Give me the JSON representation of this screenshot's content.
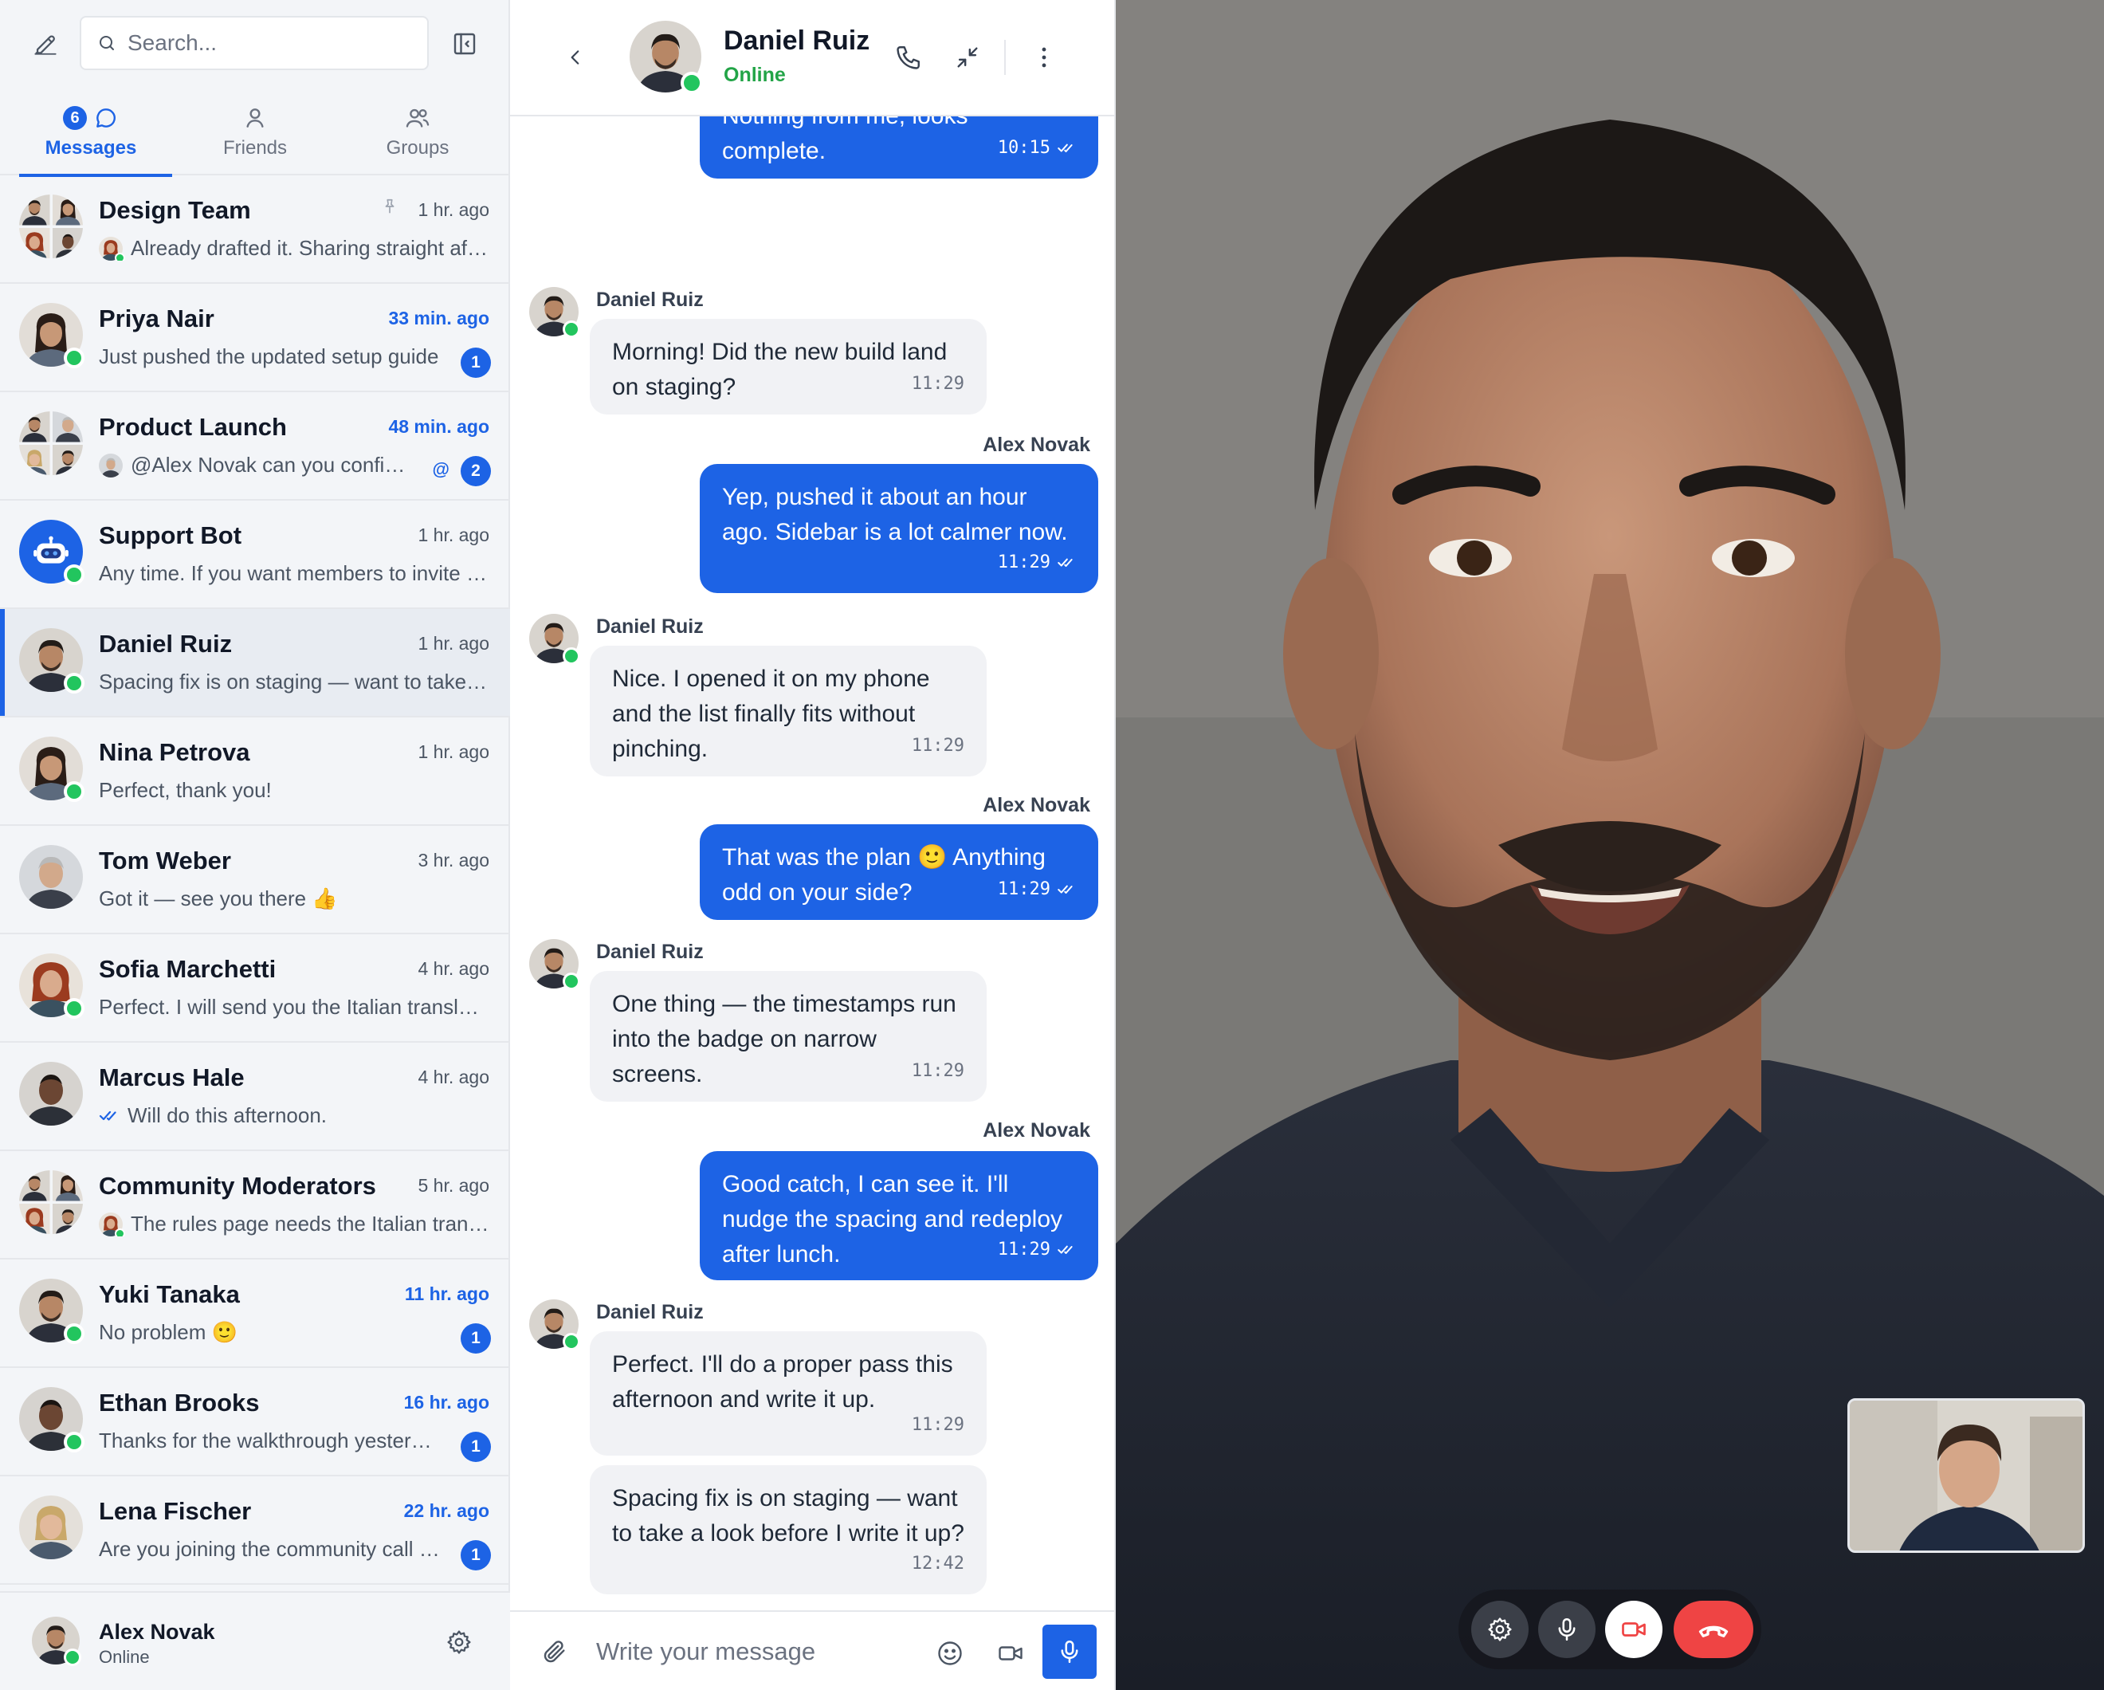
{
  "sidebar": {
    "search_placeholder": "Search...",
    "tabs": [
      {
        "label": "Messages",
        "badge": "6",
        "active": true
      },
      {
        "label": "Friends"
      },
      {
        "label": "Groups"
      }
    ],
    "conversations": [
      {
        "name": "Design Team",
        "time": "1 hr. ago",
        "preview": "Already drafted it. Sharing straight after this.",
        "pinned": true
      },
      {
        "name": "Priya Nair",
        "time": "33 min. ago",
        "preview": "Just pushed the updated setup guide",
        "unread": "1"
      },
      {
        "name": "Product Launch",
        "time": "48 min. ago",
        "preview": "@Alex Novak can you confirm the date?",
        "mention": "@",
        "unread": "2"
      },
      {
        "name": "Support Bot",
        "time": "1 hr. ago",
        "preview": "Any time. If you want members to invite others…"
      },
      {
        "name": "Daniel Ruiz",
        "time": "1 hr. ago",
        "preview": "Spacing fix is on staging — want to take a look?",
        "active": true
      },
      {
        "name": "Nina Petrova",
        "time": "1 hr. ago",
        "preview": "Perfect, thank you!"
      },
      {
        "name": "Tom Weber",
        "time": "3 hr. ago",
        "preview": "Got it — see you there 👍"
      },
      {
        "name": "Sofia Marchetti",
        "time": "4 hr. ago",
        "preview": "Perfect. I will send you the Italian translation soon."
      },
      {
        "name": "Marcus Hale",
        "time": "4 hr. ago",
        "preview": "Will do this afternoon."
      },
      {
        "name": "Community Moderators",
        "time": "5 hr. ago",
        "preview": "The rules page needs the Italian translation"
      },
      {
        "name": "Yuki Tanaka",
        "time": "11 hr. ago",
        "preview": "No problem 🙂",
        "unread": "1"
      },
      {
        "name": "Ethan Brooks",
        "time": "16 hr. ago",
        "preview": "Thanks for the walkthrough yesterday!",
        "unread": "1"
      },
      {
        "name": "Lena Fischer",
        "time": "22 hr. ago",
        "preview": "Are you joining the community call later?",
        "unread": "1"
      }
    ],
    "me": {
      "name": "Alex Novak",
      "status": "Online"
    }
  },
  "chat": {
    "contact": {
      "name": "Daniel Ruiz",
      "status": "Online"
    },
    "messages": [
      {
        "dir": "out",
        "text": "Nothing from me, looks complete.",
        "time": "10:15"
      },
      {
        "dir": "in",
        "sender": "Daniel Ruiz",
        "text": "Morning! Did the new build land on staging?",
        "time": "11:29"
      },
      {
        "dir": "out",
        "sender": "Alex Novak",
        "text": "Yep, pushed it about an hour ago. Sidebar is a lot calmer now.",
        "time": "11:29"
      },
      {
        "dir": "in",
        "sender": "Daniel Ruiz",
        "text": "Nice. I opened it on my phone and the list finally fits without pinching.",
        "time": "11:29"
      },
      {
        "dir": "out",
        "sender": "Alex Novak",
        "text": "That was the plan 🙂 Anything odd on your side?",
        "time": "11:29"
      },
      {
        "dir": "in",
        "sender": "Daniel Ruiz",
        "text": "One thing — the timestamps run into the badge on narrow screens.",
        "time": "11:29"
      },
      {
        "dir": "out",
        "sender": "Alex Novak",
        "text": "Good catch, I can see it. I'll nudge the spacing and redeploy after lunch.",
        "time": "11:29"
      },
      {
        "dir": "in",
        "sender": "Daniel Ruiz",
        "text": "Perfect. I'll do a proper pass this afternoon and write it up.",
        "time": "11:29"
      },
      {
        "dir": "in",
        "text": "Spacing fix is on staging — want to take a look before I write it up?",
        "time": "12:42"
      }
    ],
    "composer_placeholder": "Write your message"
  },
  "colors": {
    "accent": "#1d63e5",
    "online": "#22c55e",
    "hangup": "#ef4444"
  }
}
